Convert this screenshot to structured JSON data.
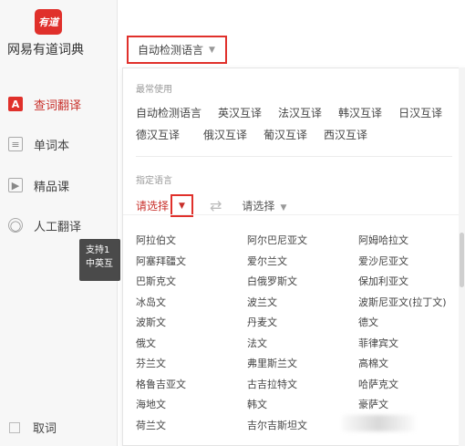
{
  "app": {
    "logo_text": "有道",
    "name": "网易有道词典"
  },
  "sidebar": {
    "items": [
      {
        "label": "查词翻译",
        "icon": "A"
      },
      {
        "label": "单词本",
        "icon": "≡"
      },
      {
        "label": "精品课",
        "icon": "▶"
      },
      {
        "label": "人工翻译",
        "icon": "◯"
      }
    ],
    "cancel_label": "取词",
    "tooltip": "支持1\n中英互"
  },
  "top_select": {
    "value": "自动检测语言",
    "caret": "▼"
  },
  "panel": {
    "common_title": "最常使用",
    "common_row1": [
      "自动检测语言",
      "英汉互译",
      "法汉互译",
      "韩汉互译",
      "日汉互译"
    ],
    "common_row2": [
      "德汉互译",
      "俄汉互译",
      "葡汉互译",
      "西汉互译"
    ],
    "specify_title": "指定语言",
    "from_placeholder": "请选择",
    "to_placeholder": "请选择",
    "caret": "▼",
    "swap": "⇄",
    "languages": [
      [
        "阿拉伯文",
        "阿尔巴尼亚文",
        "阿姆哈拉文"
      ],
      [
        "阿塞拜疆文",
        "爱尔兰文",
        "爱沙尼亚文"
      ],
      [
        "巴斯克文",
        "白俄罗斯文",
        "保加利亚文"
      ],
      [
        "冰岛文",
        "波兰文",
        "波斯尼亚文(拉丁文)"
      ],
      [
        "波斯文",
        "丹麦文",
        "德文"
      ],
      [
        "俄文",
        "法文",
        "菲律宾文"
      ],
      [
        "芬兰文",
        "弗里斯兰文",
        "高棉文"
      ],
      [
        "格鲁吉亚文",
        "古吉拉特文",
        "哈萨克文"
      ],
      [
        "海地文",
        "韩文",
        "豪萨文"
      ],
      [
        "荷兰文",
        "吉尔吉斯坦文",
        ""
      ]
    ]
  }
}
